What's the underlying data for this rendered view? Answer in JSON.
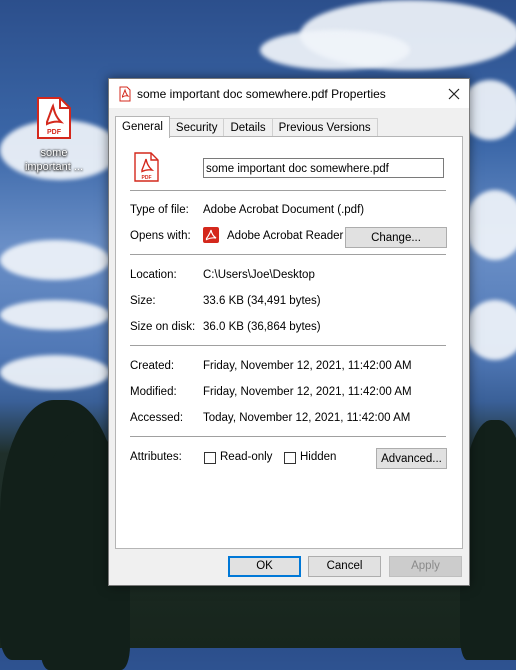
{
  "desktop": {
    "icon_label_line1": "some",
    "icon_label_line2": "important ...",
    "icon_badge": "PDF",
    "icon_name": "pdf-file-icon"
  },
  "dialog": {
    "title": "some important doc somewhere.pdf Properties",
    "tabs": [
      {
        "label": "General",
        "active": true
      },
      {
        "label": "Security",
        "active": false
      },
      {
        "label": "Details",
        "active": false
      },
      {
        "label": "Previous Versions",
        "active": false
      }
    ],
    "file_badge": "PDF",
    "filename": "some important doc somewhere.pdf",
    "type_label": "Type of file:",
    "type_value": "Adobe Acrobat Document (.pdf)",
    "opens_label": "Opens with:",
    "opens_value": "Adobe Acrobat Reader",
    "change_button": "Change...",
    "location_label": "Location:",
    "location_value": "C:\\Users\\Joe\\Desktop",
    "size_label": "Size:",
    "size_value": "33.6 KB (34,491 bytes)",
    "size_disk_label": "Size on disk:",
    "size_disk_value": "36.0 KB (36,864 bytes)",
    "created_label": "Created:",
    "created_value": "Friday, November 12, 2021, 11:42:00 AM",
    "modified_label": "Modified:",
    "modified_value": "Friday, November 12, 2021, 11:42:00 AM",
    "accessed_label": "Accessed:",
    "accessed_value": "Today, November 12, 2021, 11:42:00 AM",
    "attributes_label": "Attributes:",
    "readonly_label": "Read-only",
    "readonly_checked": false,
    "hidden_label": "Hidden",
    "hidden_checked": false,
    "advanced_button": "Advanced...",
    "ok_button": "OK",
    "cancel_button": "Cancel",
    "apply_button": "Apply",
    "apply_enabled": false
  },
  "colors": {
    "pdf_red": "#d4281c",
    "focus_blue": "#0078d7"
  }
}
